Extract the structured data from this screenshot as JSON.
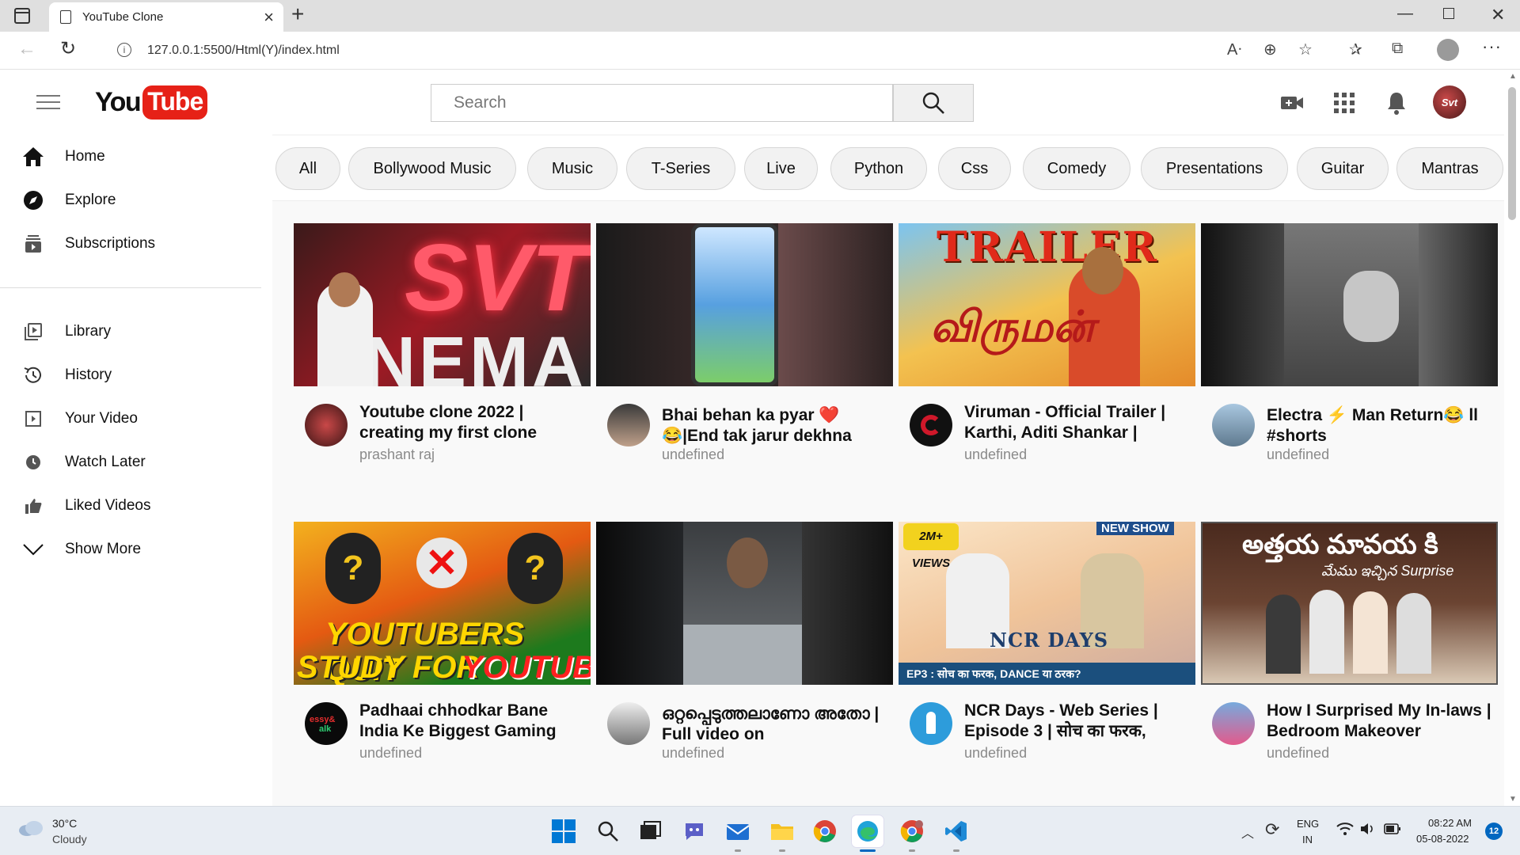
{
  "browser": {
    "tab_title": "YouTube Clone",
    "url": "127.0.0.1:5500/Html(Y)/index.html"
  },
  "youtube": {
    "search_placeholder": "Search",
    "sidebar_primary": [
      {
        "label": "Home",
        "icon": "home-icon"
      },
      {
        "label": "Explore",
        "icon": "compass-icon"
      },
      {
        "label": "Subscriptions",
        "icon": "subscriptions-icon"
      }
    ],
    "sidebar_secondary": [
      {
        "label": "Library",
        "icon": "library-icon"
      },
      {
        "label": "History",
        "icon": "history-icon"
      },
      {
        "label": "Your Video",
        "icon": "your-video-icon"
      },
      {
        "label": "Watch Later",
        "icon": "clock-icon"
      },
      {
        "label": "Liked Videos",
        "icon": "thumbs-up-icon"
      },
      {
        "label": "Show More",
        "icon": "chevron-down-icon"
      }
    ],
    "chips": [
      "All",
      "Bollywood Music",
      "Music",
      "T-Series",
      "Live",
      "Python",
      "Css",
      "Comedy",
      "Presentations",
      "Guitar",
      "Mantras"
    ],
    "videos": [
      {
        "title": "Youtube clone 2022 | creating my first clone",
        "channel": "prashant raj"
      },
      {
        "title": "Bhai behan ka pyar ❤️ 😂|End tak jarur dekhna",
        "channel": "undefined"
      },
      {
        "title": "Viruman - Official Trailer | Karthi, Aditi Shankar |",
        "channel": "undefined"
      },
      {
        "title": "Electra ⚡ Man Return😂 ll #shorts",
        "channel": "undefined"
      },
      {
        "title": "Padhaai chhodkar Bane India Ke Biggest Gaming",
        "channel": "undefined"
      },
      {
        "title": "ഒറ്റപ്പെടുത്തലാണോ അതോ | Full video on",
        "channel": "undefined"
      },
      {
        "title": "NCR Days - Web Series | Episode 3 | सोच का फरक,",
        "channel": "undefined"
      },
      {
        "title": "How I Surprised My In-laws | Bedroom Makeover",
        "channel": "undefined"
      }
    ],
    "thumbnail_text": {
      "t0": "SVT",
      "t0b": "INEMA",
      "t2": "TRAILER",
      "t4a": "YOUTUBERS QUIT",
      "t4b": "STUDY FOR",
      "t4c": "YOUTUBE",
      "t6a": "2M+ VIEWS",
      "t6b": "NEW SHOW",
      "t6c": "NCR DAYS",
      "t6d": "EP3 : सोच का फरक, DANCE या ठरक?",
      "t7a": "అత్తయ మావయ కి"
    }
  },
  "taskbar": {
    "temperature": "30°C",
    "weather": "Cloudy",
    "lang_1": "ENG",
    "lang_2": "IN",
    "time": "08:22 AM",
    "date": "05-08-2022",
    "notifications": "12"
  },
  "colors": {
    "youtube_red": "#e62117",
    "chip_bg": "#f2f2f2",
    "accent_blue": "#0067c0"
  }
}
